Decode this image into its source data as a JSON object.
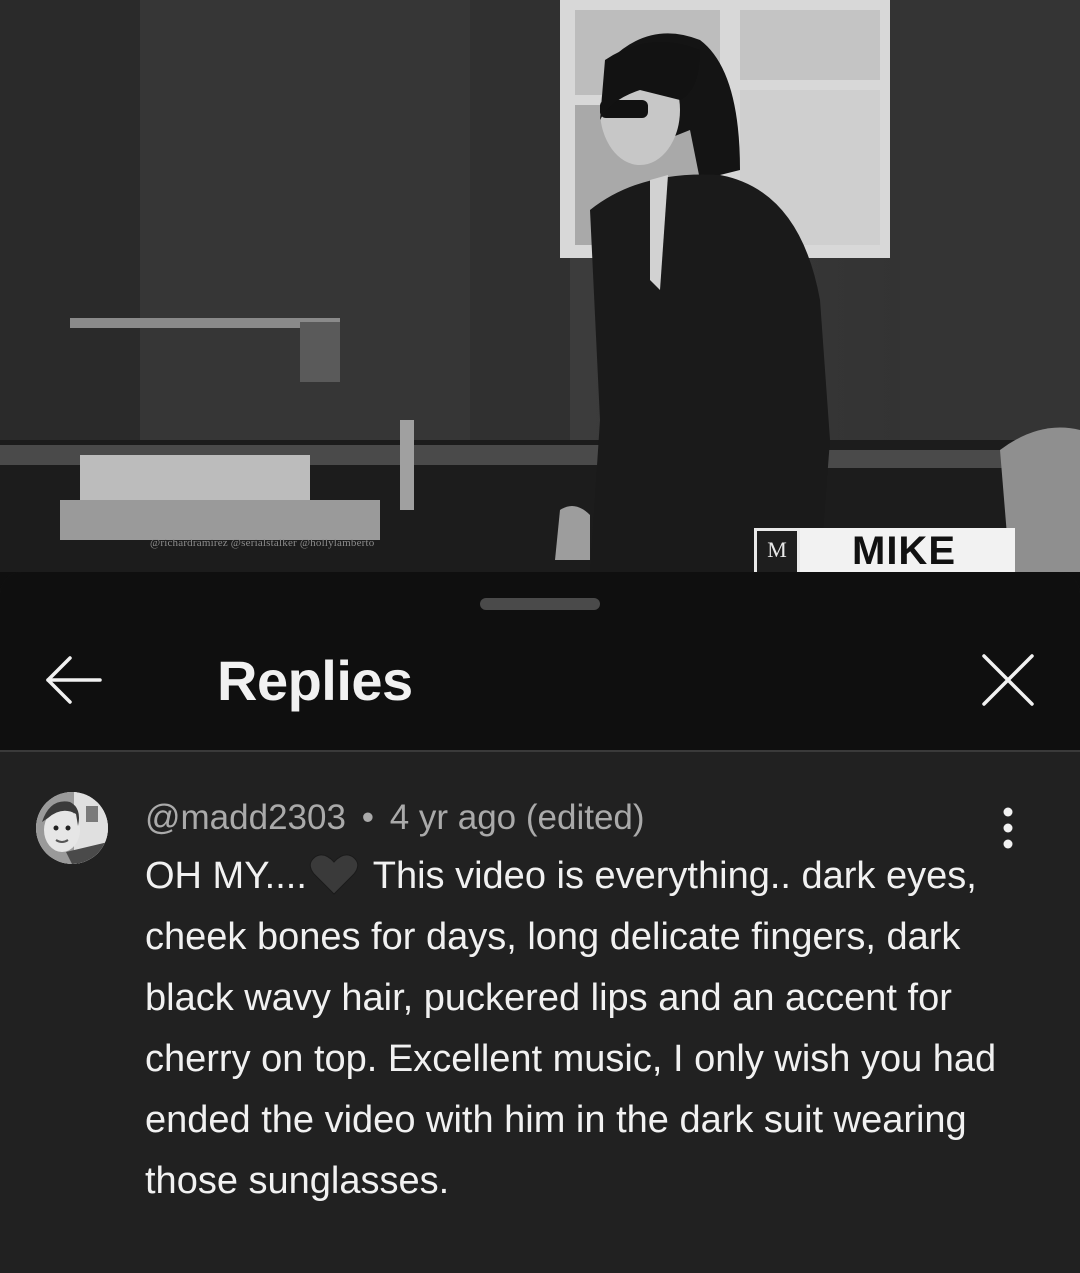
{
  "video": {
    "watermark": "@richardramirez  @serialstalker  @hollylamberto",
    "lower_third": {
      "logo": "M",
      "name": "MIKE"
    }
  },
  "sheet": {
    "title": "Replies",
    "back_icon": "arrow-left-icon",
    "close_icon": "close-icon"
  },
  "comment": {
    "author": "@madd2303",
    "separator": "•",
    "timestamp": "4 yr ago (edited)",
    "text_before_emoji": "OH MY....",
    "emoji": "black-heart-icon",
    "text_after_emoji": " This video is everything.. dark eyes, cheek bones for days, long delicate fingers, dark black wavy hair, puckered lips and an accent for cherry on top. Excellent music, I only wish you had ended the video with him in the dark suit wearing those sunglasses.",
    "more_icon": "more-vertical-icon"
  }
}
